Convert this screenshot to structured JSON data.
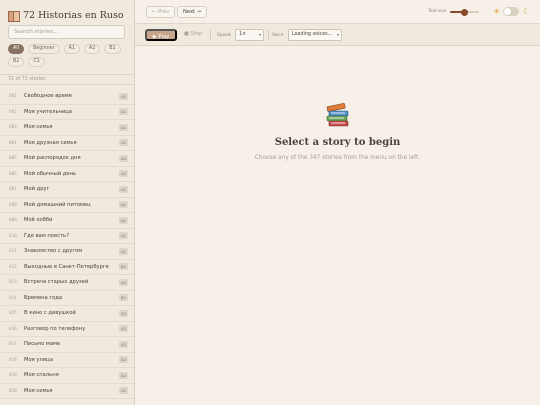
{
  "sidebar": {
    "brand_title": "72 Historias en Ruso",
    "search_placeholder": "Search stories...",
    "levels": [
      "All",
      "Beginner",
      "A1",
      "A2",
      "B1",
      "B2",
      "C1"
    ],
    "active_level": "All",
    "count_text": "72 of 72 stories",
    "stories": [
      {
        "num": "001",
        "title": "Свободное время",
        "level": "A1"
      },
      {
        "num": "002",
        "title": "Моя учительница",
        "level": "A1"
      },
      {
        "num": "003",
        "title": "Моя семья",
        "level": "A1"
      },
      {
        "num": "004",
        "title": "Моя друзная семья",
        "level": "A1"
      },
      {
        "num": "005",
        "title": "Мой распорядок дня",
        "level": "A2"
      },
      {
        "num": "006",
        "title": "Мой обычный день",
        "level": "A2"
      },
      {
        "num": "007",
        "title": "Мой друг",
        "level": "A1"
      },
      {
        "num": "008",
        "title": "Мой домашний питомец",
        "level": "A1"
      },
      {
        "num": "009",
        "title": "Моё хобби",
        "level": "A1"
      },
      {
        "num": "010",
        "title": "Где вам поесть?",
        "level": "A1"
      },
      {
        "num": "011",
        "title": "Знакомство с другом",
        "level": "A1"
      },
      {
        "num": "012",
        "title": "Выходные в Санкт-Петербурге",
        "level": "B1"
      },
      {
        "num": "013",
        "title": "Встреча старых друзей",
        "level": "A2"
      },
      {
        "num": "014",
        "title": "Времена года",
        "level": "B1"
      },
      {
        "num": "015",
        "title": "В кино с девушкой",
        "level": "A2"
      },
      {
        "num": "016",
        "title": "Разговор по телефону",
        "level": "A2"
      },
      {
        "num": "017",
        "title": "Письмо маме",
        "level": "A2"
      },
      {
        "num": "018",
        "title": "Моя улица",
        "level": "A2"
      },
      {
        "num": "019",
        "title": "Моя спальня",
        "level": "A2"
      },
      {
        "num": "020",
        "title": "Моя семья",
        "level": "A1"
      }
    ]
  },
  "topbar": {
    "prev_label": "← Prev",
    "next_label": "Next →",
    "textsize_label": "Text size",
    "textsize_value": 0.5,
    "theme": "light"
  },
  "player": {
    "play_label": "▶ Play",
    "stop_label": "■ Stop",
    "speed_label": "Speed",
    "speed_value": "1×",
    "voice_label": "Voice",
    "voice_value": "Loading voices..."
  },
  "empty_state": {
    "icon": "books-icon",
    "title": "Select a story to begin",
    "subtitle": "Choose any of the 347 stories from the menu on the left."
  },
  "colors": {
    "accent": "#8a4a2e",
    "play_button": "#c6a48c",
    "active_chip": "#8a7262",
    "background": "#f6f0e8",
    "sidebar": "#efe9de"
  }
}
